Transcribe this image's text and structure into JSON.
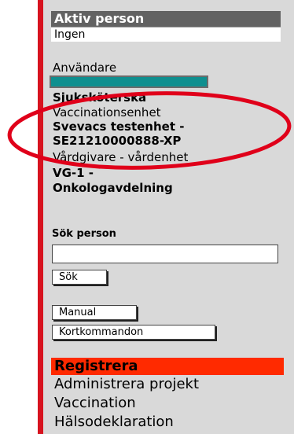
{
  "active_person": {
    "heading": "Aktiv person",
    "value": "Ingen"
  },
  "user_info": {
    "label": "Användare",
    "role": "Sjuksköterska",
    "vaccination_unit_label": "Vaccinationsenhet",
    "vaccination_unit_value_line1": "Svevacs testenhet -",
    "vaccination_unit_value_line2": "SE21210000888-XP",
    "caregiver_unit_label": "Vårdgivare - vårdenhet",
    "caregiver_unit_value_line1": "VG-1 -",
    "caregiver_unit_value_line2": "Onkologavdelning"
  },
  "search": {
    "label": "Sök person",
    "input_value": "",
    "button_label": "Sök"
  },
  "buttons": {
    "manual_label": "Manual",
    "shortcuts_label": "Kortkommandon"
  },
  "register_menu": {
    "heading": "Registrera",
    "items": [
      "Administrera projekt",
      "Vaccination",
      "Hälsodeklaration"
    ]
  },
  "colors": {
    "left_border": "#d7131f",
    "panel_bg": "#d9d9d9",
    "active_header_bg": "#626262",
    "user_field": "#0f8f8f",
    "register_header_bg": "#ff2a00",
    "highlight_ellipse": "#e0001a"
  }
}
